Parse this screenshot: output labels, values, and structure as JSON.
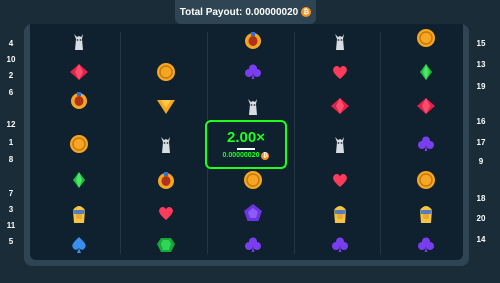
{
  "header": {
    "total_payout_label": "Total Payout:",
    "total_payout_value": "0.00000020",
    "currency_icon": "bitcoin-coin-icon"
  },
  "left_numbers": [
    "4",
    "10",
    "2",
    "6",
    "12",
    "1",
    "8",
    "7",
    "3",
    "11",
    "5"
  ],
  "right_numbers": [
    "15",
    "13",
    "19",
    "16",
    "17",
    "9",
    "18",
    "20",
    "14"
  ],
  "win": {
    "multiplier": "2.00×",
    "amount": "0.00000020"
  },
  "columns": [
    [
      "cat",
      "gem-red",
      "scarab",
      "blank",
      "coin",
      "blank",
      "gem-green",
      "pharaoh",
      "spade-blue"
    ],
    [
      "blank",
      "coin",
      "blank",
      "triangle",
      "cat",
      "scarab",
      "heart",
      "gem-emerald"
    ],
    [
      "blank",
      "scarab",
      "clover",
      "cat",
      "blank",
      "coin",
      "pentagon",
      "clover"
    ],
    [
      "cat",
      "heart",
      "gem-red",
      "cat",
      "heart",
      "pharaoh",
      "clover"
    ],
    [
      "coin",
      "gem-green",
      "gem-red",
      "clover",
      "coin",
      "pharaoh",
      "clover"
    ]
  ],
  "colors": {
    "background": "#1a2c38",
    "board": "#2f4553",
    "grid": "#0f212e",
    "win_green": "#1fff20",
    "coin_orange": "#f7931a"
  }
}
